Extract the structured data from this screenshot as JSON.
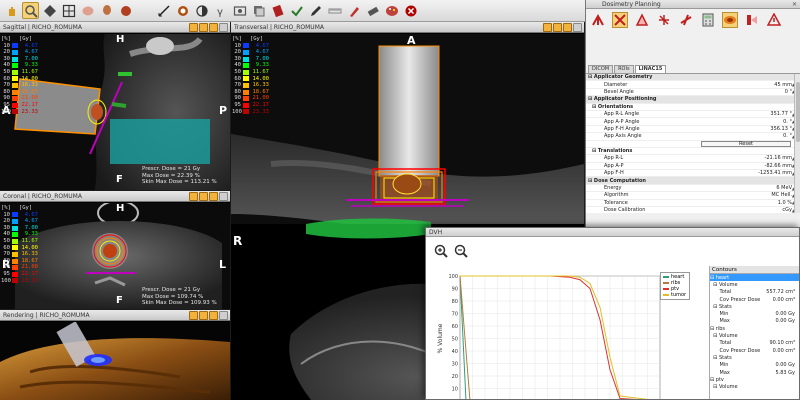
{
  "app": {
    "toolbar_tools": [
      "hand-icon",
      "zoom-icon",
      "window-level-icon",
      "layout-icon",
      "brain-icon",
      "head-icon",
      "organ-icon",
      "kidney-icon",
      "measure-icon",
      "dose-icon",
      "contrast-icon",
      "gamma-icon",
      "screen-capture-icon",
      "stack-icon",
      "applicator-icon",
      "check-icon",
      "pencil-icon",
      "ruler-icon",
      "brush-icon",
      "eraser-icon",
      "palette-icon",
      "close-icon"
    ]
  },
  "dose_legend": {
    "pct_header": "[%]",
    "gy_header": "[Gy]",
    "rows": [
      {
        "pct": "10",
        "gy": "4.67",
        "color": "#0a3cff"
      },
      {
        "pct": "20",
        "gy": "4.67",
        "color": "#00a0ff"
      },
      {
        "pct": "30",
        "gy": "7.00",
        "color": "#00e0e0"
      },
      {
        "pct": "40",
        "gy": "9.33",
        "color": "#00ff00"
      },
      {
        "pct": "50",
        "gy": "11.67",
        "color": "#a0ff00"
      },
      {
        "pct": "60",
        "gy": "14.00",
        "color": "#ffff00"
      },
      {
        "pct": "70",
        "gy": "16.33",
        "color": "#ffc000"
      },
      {
        "pct": "80",
        "gy": "18.67",
        "color": "#ff8000"
      },
      {
        "pct": "90",
        "gy": "21.00",
        "color": "#ff4000"
      },
      {
        "pct": "95",
        "gy": "22.17",
        "color": "#ff0000"
      },
      {
        "pct": "100",
        "gy": "23.33",
        "color": "#c00000"
      }
    ]
  },
  "views": {
    "sagittal": {
      "title": "Sagittal | RICHO_ROMUMA",
      "top": "H",
      "left": "A",
      "right": "P",
      "bottom": "F",
      "readout": [
        "Prescr. Dose = 21 Gy",
        "Max Dose = 22.39 %",
        "Skin Max Dose = 113.21 %"
      ]
    },
    "coronal": {
      "title": "Coronal | RICHO_ROMUMA",
      "top": "H",
      "left": "R",
      "right": "L",
      "bottom": "F",
      "readout": [
        "Prescr. Dose = 21 Gy",
        "Max Dose = 109.74 %",
        "Skin Max Dose = 109.93 %"
      ]
    },
    "rendering": {
      "title": "Rendering | RICHO_ROMUMA"
    },
    "transversal": {
      "title": "Transversal | RICHO_ROMUMA",
      "top": "A",
      "left": "R"
    }
  },
  "dosimetry": {
    "title": "Dosimetry Planning",
    "tabs": [
      "DICOM",
      "ROIs",
      "LINAC15"
    ],
    "grid": [
      {
        "type": "section",
        "key": "Applicator Geometry"
      },
      {
        "type": "prop",
        "key": "Diameter",
        "val": "45 mm"
      },
      {
        "type": "prop",
        "key": "Bevel Angle",
        "val": "0 °"
      },
      {
        "type": "section",
        "key": "Applicator Positioning"
      },
      {
        "type": "sub",
        "key": "Orientations"
      },
      {
        "type": "prop",
        "key": "App R-L Angle",
        "val": "351.77 °"
      },
      {
        "type": "prop",
        "key": "App A-P Angle",
        "val": "0. °"
      },
      {
        "type": "prop",
        "key": "App F-H Angle",
        "val": "356.13 °"
      },
      {
        "type": "prop",
        "key": "App Axis Angle",
        "val": "0. °"
      },
      {
        "type": "button",
        "key": "Reset"
      },
      {
        "type": "sub",
        "key": "Translations"
      },
      {
        "type": "prop",
        "key": "App R-L",
        "val": "-21.16 mm"
      },
      {
        "type": "prop",
        "key": "App A-P",
        "val": "-82.66 mm"
      },
      {
        "type": "prop",
        "key": "App F-H",
        "val": "-1253.41 mm"
      },
      {
        "type": "section",
        "key": "Dose Computation"
      },
      {
        "type": "prop",
        "key": "Energy",
        "val": "6 MeV"
      },
      {
        "type": "prop",
        "key": "Algorithm",
        "val": "MC Hell."
      },
      {
        "type": "prop",
        "key": "Tolerance",
        "val": "1.0 %"
      },
      {
        "type": "prop",
        "key": "Dose Calibration",
        "val": "cGy"
      }
    ]
  },
  "dvh": {
    "title": "DVH",
    "y_axis_label": "% Volume",
    "legend": [
      {
        "name": "heart",
        "color": "#2e9e7a"
      },
      {
        "name": "ribs",
        "color": "#b87a3a"
      },
      {
        "name": "ptv",
        "color": "#e03030"
      },
      {
        "name": "tumor",
        "color": "#e0c020"
      }
    ]
  },
  "chart_data": {
    "type": "line",
    "ylabel": "% Volume",
    "ylim": [
      0,
      100
    ],
    "yticks": [
      100,
      90,
      80,
      70,
      60,
      50,
      40,
      30,
      20,
      10,
      0
    ],
    "grid": true,
    "legend": "right",
    "series": [
      {
        "name": "heart",
        "color": "#2e9e7a",
        "x": [
          0,
          0.03,
          1
        ],
        "y": [
          100,
          0,
          0
        ]
      },
      {
        "name": "ribs",
        "color": "#b87a3a",
        "x": [
          0,
          0.05,
          1
        ],
        "y": [
          100,
          0,
          0
        ]
      },
      {
        "name": "ptv",
        "color": "#e03030",
        "x": [
          0,
          0.45,
          0.55,
          0.6,
          0.65,
          0.7,
          0.75,
          0.8,
          1
        ],
        "y": [
          100,
          100,
          99,
          97,
          90,
          65,
          25,
          2,
          0
        ]
      },
      {
        "name": "tumor",
        "color": "#e0c020",
        "x": [
          0,
          0.45,
          0.55,
          0.6,
          0.65,
          0.7,
          0.75,
          0.8,
          1
        ],
        "y": [
          100,
          100,
          100,
          99,
          94,
          75,
          35,
          4,
          0
        ]
      }
    ]
  },
  "contours": {
    "header": "Contours",
    "rows": [
      {
        "type": "sel",
        "key": "⊟ heart",
        "val": ""
      },
      {
        "type": "k",
        "key": "  ⊟ Volume",
        "val": ""
      },
      {
        "type": "k",
        "key": "      Total",
        "val": "557.72 cm³"
      },
      {
        "type": "k",
        "key": "      Cov Prescr Dose",
        "val": "0.00 cm³"
      },
      {
        "type": "k",
        "key": "  ⊟ Stats",
        "val": ""
      },
      {
        "type": "k",
        "key": "      Min",
        "val": "0.00 Gy"
      },
      {
        "type": "k",
        "key": "      Max",
        "val": "0.00 Gy"
      },
      {
        "type": "k",
        "key": "⊟ ribs",
        "val": ""
      },
      {
        "type": "k",
        "key": "  ⊟ Volume",
        "val": ""
      },
      {
        "type": "k",
        "key": "      Total",
        "val": "90.10 cm³"
      },
      {
        "type": "k",
        "key": "      Cov Prescr Dose",
        "val": "0.00 cm³"
      },
      {
        "type": "k",
        "key": "  ⊟ Stats",
        "val": ""
      },
      {
        "type": "k",
        "key": "      Min",
        "val": "0.00 Gy"
      },
      {
        "type": "k",
        "key": "      Max",
        "val": "5.83 Gy"
      },
      {
        "type": "k",
        "key": "⊟ ptv",
        "val": ""
      },
      {
        "type": "k",
        "key": "  ⊟ Volume",
        "val": ""
      }
    ]
  }
}
